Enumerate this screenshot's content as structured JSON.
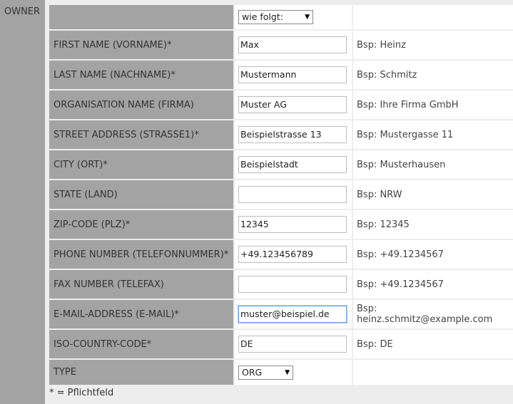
{
  "section_label": "OWNER",
  "handle_select": {
    "value": "wie folgt:"
  },
  "fields": [
    {
      "label": "FIRST NAME (VORNAME)*",
      "value": "Max",
      "hint": "Bsp: Heinz"
    },
    {
      "label": "LAST NAME (NACHNAME)*",
      "value": "Mustermann",
      "hint": "Bsp: Schmitz"
    },
    {
      "label": "ORGANISATION NAME (FIRMA)",
      "value": "Muster AG",
      "hint": "Bsp: Ihre Firma GmbH"
    },
    {
      "label": "STREET ADDRESS (STRASSE1)*",
      "value": "Beispielstrasse 13",
      "hint": "Bsp: Mustergasse 11"
    },
    {
      "label": "CITY (ORT)*",
      "value": "Beispielstadt",
      "hint": "Bsp: Musterhausen"
    },
    {
      "label": "STATE (LAND)",
      "value": "",
      "hint": "Bsp: NRW"
    },
    {
      "label": "ZIP-CODE (PLZ)*",
      "value": "12345",
      "hint": "Bsp: 12345"
    },
    {
      "label": "PHONE NUMBER (TELEFONNUMMER)*",
      "value": "+49.123456789",
      "hint": "Bsp: +49.1234567"
    },
    {
      "label": "FAX NUMBER (TELEFAX)",
      "value": "",
      "hint": "Bsp: +49.1234567"
    },
    {
      "label": "E-MAIL-ADDRESS (E-MAIL)*",
      "value": "muster@beispiel.de",
      "hint": "Bsp: heinz.schmitz@example.com"
    },
    {
      "label": "ISO-COUNTRY-CODE*",
      "value": "DE",
      "hint": "Bsp: DE"
    }
  ],
  "type_row": {
    "label": "TYPE",
    "value": "ORG"
  },
  "footnote": "* = Pflichtfeld"
}
